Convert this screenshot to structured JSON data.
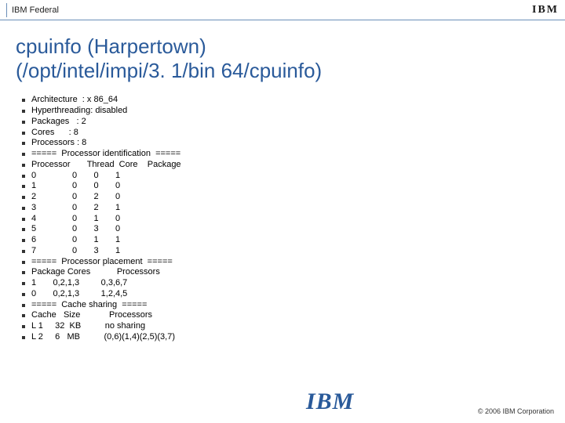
{
  "header": {
    "brand_left": "IBM Federal",
    "brand_right": "IBM"
  },
  "title": {
    "line1": "cpuinfo (Harpertown)",
    "line2": "(/opt/intel/impi/3. 1/bin 64/cpuinfo)"
  },
  "lines": [
    "Architecture  : x 86_64",
    "Hyperthreading: disabled",
    "Packages   : 2",
    "Cores      : 8",
    "Processors : 8",
    "=====  Processor identification  =====",
    "Processor       Thread  Core    Package",
    "0               0       0       1",
    "1               0       0       0",
    "2               0       2       0",
    "3               0       2       1",
    "4               0       1       0",
    "5               0       3       0",
    "6               0       1       1",
    "7               0       3       1",
    "=====  Processor placement  =====",
    "Package Cores           Processors",
    "1       0,2,1,3         0,3,6,7",
    "0       0,2,1,3         1,2,4,5",
    "=====  Cache sharing  =====",
    "Cache   Size            Processors",
    "L 1     32  KB          no sharing",
    "L 2     6   MB          (0,6)(1,4)(2,5)(3,7)"
  ],
  "footer": {
    "logo": "IBM",
    "copyright": "© 2006 IBM Corporation"
  }
}
